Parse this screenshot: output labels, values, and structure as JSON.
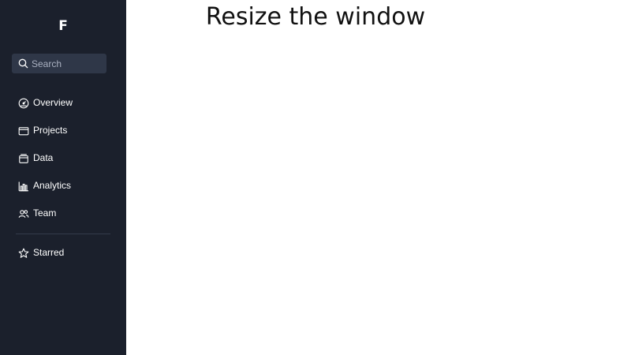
{
  "sidebar": {
    "logo": "F",
    "search": {
      "placeholder": "Search",
      "value": "",
      "icon": "search-icon"
    },
    "items": [
      {
        "label": "Overview",
        "icon": "dashboard-icon"
      },
      {
        "label": "Projects",
        "icon": "folder-icon"
      },
      {
        "label": "Data",
        "icon": "archive-icon"
      },
      {
        "label": "Analytics",
        "icon": "bar-chart-icon"
      },
      {
        "label": "Team",
        "icon": "users-icon"
      }
    ],
    "starred": {
      "label": "Starred",
      "icon": "star-icon"
    }
  },
  "main": {
    "title": "Resize the window"
  },
  "colors": {
    "sidebar_bg": "#1b202c",
    "search_bg": "#2f3748",
    "text_light": "#ffffff",
    "placeholder": "#a9b0c0",
    "main_bg": "#ffffff",
    "title_text": "#111111"
  }
}
